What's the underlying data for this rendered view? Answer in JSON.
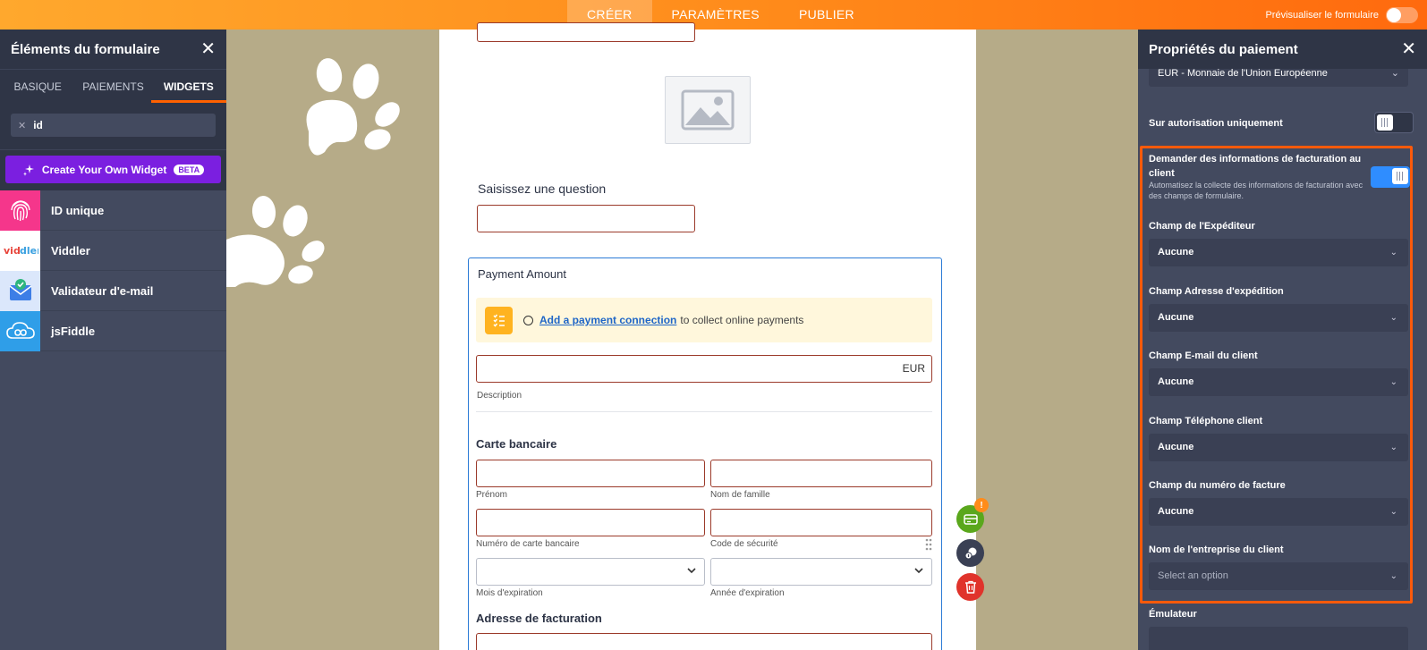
{
  "topbar": {
    "tabs": [
      {
        "label": "CRÉER"
      },
      {
        "label": "PARAMÈTRES"
      },
      {
        "label": "PUBLIER"
      }
    ],
    "preview_label": "Prévisualiser le formulaire"
  },
  "left_panel": {
    "title": "Éléments du formulaire",
    "tabs": [
      {
        "label": "BASIQUE"
      },
      {
        "label": "PAIEMENTS"
      },
      {
        "label": "WIDGETS"
      }
    ],
    "search_value": "id",
    "create_button": "Create Your Own Widget",
    "create_badge": "BETA",
    "widgets": [
      {
        "label": "ID unique",
        "icon": "fingerprint-icon"
      },
      {
        "label": "Viddler",
        "icon": "viddler-logo-icon"
      },
      {
        "label": "Validateur d'e-mail",
        "icon": "email-check-icon"
      },
      {
        "label": "jsFiddle",
        "icon": "cloud-icon"
      }
    ]
  },
  "form": {
    "question_label": "Saisissez une question",
    "payment": {
      "title": "Payment Amount",
      "notice_link": "Add a payment connection",
      "notice_text": "to collect online payments",
      "currency_suffix": "EUR",
      "description_label": "Description",
      "card_heading": "Carte bancaire",
      "first_name_label": "Prénom",
      "last_name_label": "Nom de famille",
      "card_number_label": "Numéro de carte bancaire",
      "security_code_label": "Code de sécurité",
      "exp_month_label": "Mois d'expiration",
      "exp_year_label": "Année d'expiration",
      "billing_heading": "Adresse de facturation"
    },
    "badge_count": "!"
  },
  "right_panel": {
    "title": "Propriétés du paiement",
    "currency_value": "EUR - Monnaie de l'Union Européenne",
    "authorization_label": "Sur autorisation uniquement",
    "billing_info": {
      "label": "Demander des informations de facturation au client",
      "description": "Automatisez la collecte des informations de facturation avec des champs de formulaire."
    },
    "fields": [
      {
        "label": "Champ de l'Expéditeur",
        "value": "Aucune"
      },
      {
        "label": "Champ Adresse d'expédition",
        "value": "Aucune"
      },
      {
        "label": "Champ E-mail du client",
        "value": "Aucune"
      },
      {
        "label": "Champ Téléphone client",
        "value": "Aucune"
      },
      {
        "label": "Champ du numéro de facture",
        "value": "Aucune"
      },
      {
        "label": "Nom de l'entreprise du client",
        "value": "Select an option"
      }
    ],
    "emulator_label": "Émulateur"
  },
  "colors": {
    "accent": "#ff6100",
    "highlight": "#ff5a0a",
    "toggle_on": "#2f8dff",
    "canvas_bg": "#b6ab88"
  }
}
